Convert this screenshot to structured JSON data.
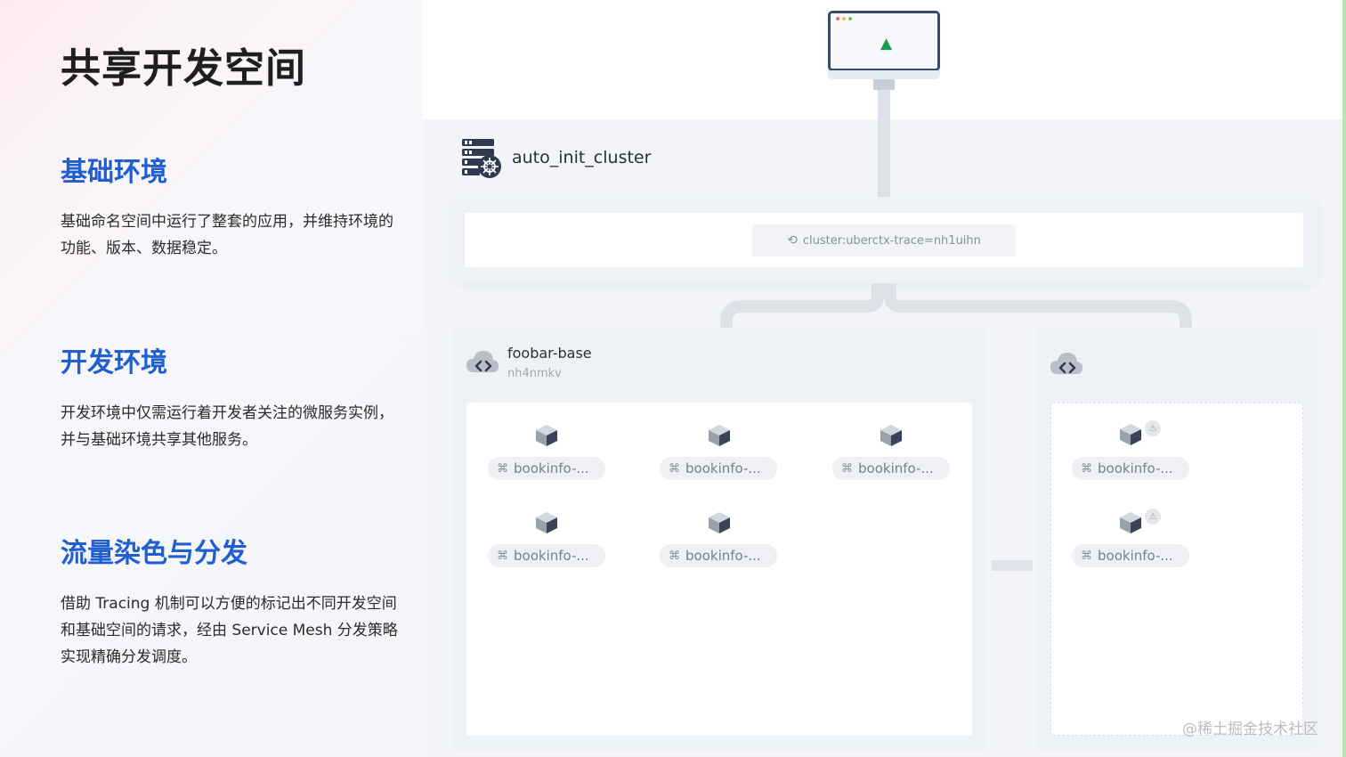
{
  "page": {
    "title": "共享开发空间",
    "watermark": "@稀土掘金技术社区"
  },
  "sections": [
    {
      "heading": "基础环境",
      "body": "基础命名空间中运行了整套的应用，并维持环境的功能、版本、数据稳定。"
    },
    {
      "heading": "开发环境",
      "body": "开发环境中仅需运行着开发者关注的微服务实例，并与基础环境共享其他服务。"
    },
    {
      "heading": "流量染色与分发",
      "body": "借助 Tracing 机制可以方便的标记出不同开发空间和基础空间的请求，经由 Service Mesh 分发策略实现精确分发调度。"
    }
  ],
  "diagram": {
    "cluster": {
      "name": "auto_init_cluster",
      "icon": "kubernetes-server-icon"
    },
    "route": {
      "label": "cluster:uberctx-trace=nh1uihn",
      "icon": "route-icon"
    },
    "namespaces": [
      {
        "name": "foobar-base",
        "id": "nh4nmkv",
        "icon": "cloud-code-icon",
        "workloads": [
          {
            "label": "bookinfo-..."
          },
          {
            "label": "bookinfo-..."
          },
          {
            "label": "bookinfo-..."
          },
          {
            "label": "bookinfo-..."
          },
          {
            "label": "bookinfo-..."
          }
        ]
      },
      {
        "name": "",
        "id": "",
        "icon": "cloud-code-icon",
        "workloads": [
          {
            "label": "bookinfo-...",
            "badge": "warning-icon"
          },
          {
            "label": "bookinfo-...",
            "badge": "warning-icon"
          }
        ]
      }
    ]
  },
  "colors": {
    "accent_blue": "#1f5fcf",
    "cursor_green": "#1a9c4f",
    "monitor_frame": "#3a4a6a",
    "panel_bg": "#f2f4f7"
  }
}
